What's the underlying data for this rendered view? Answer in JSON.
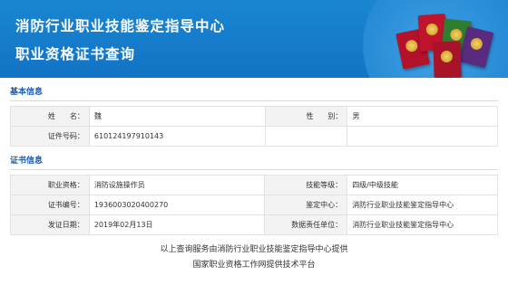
{
  "header": {
    "title_line1": "消防行业职业技能鉴定指导中心",
    "title_line2": "职业资格证书查询"
  },
  "basic": {
    "section_title": "基本信息",
    "name_label": "姓　　名：",
    "name_value": "魏",
    "gender_label": "性　　别：",
    "gender_value": "男",
    "id_label": "证件号码：",
    "id_value": "610124197910143"
  },
  "cert": {
    "section_title": "证书信息",
    "qualification_label": "职业资格：",
    "qualification_value": "消防设施操作员",
    "skill_level_label": "技能等级：",
    "skill_level_value": "四级/中级技能",
    "cert_no_label": "证书编号：",
    "cert_no_value": "1936003020400270",
    "appraisal_center_label": "鉴定中心：",
    "appraisal_center_value": "消防行业职业技能鉴定指导中心",
    "issue_date_label": "发证日期：",
    "issue_date_value": "2019年02月13日",
    "data_unit_label": "数据责任单位：",
    "data_unit_value": "消防行业职业技能鉴定指导中心"
  },
  "footer": {
    "line1": "以上查询服务由消防行业职业技能鉴定指导中心提供",
    "line2": "国家职业资格工作网提供技术平台"
  }
}
